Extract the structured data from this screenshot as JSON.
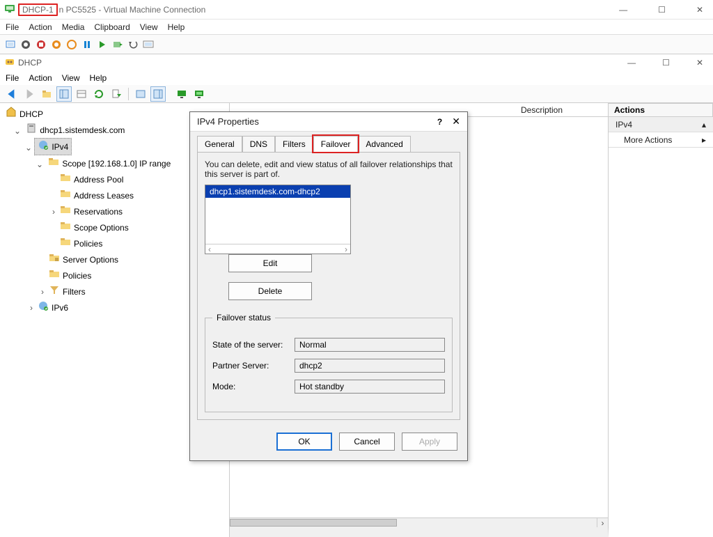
{
  "vm": {
    "title_highlighted": "DHCP-1",
    "title_rest": "n PC5525 - Virtual Machine Connection",
    "menu": [
      "File",
      "Action",
      "Media",
      "Clipboard",
      "View",
      "Help"
    ]
  },
  "inner": {
    "title": "DHCP",
    "menu": [
      "File",
      "Action",
      "View",
      "Help"
    ]
  },
  "tree": {
    "root": "DHCP",
    "server": "dhcp1.sistemdesk.com",
    "ipv4": "IPv4",
    "scope": "Scope [192.168.1.0] IP range",
    "scope_children": [
      "Address Pool",
      "Address Leases",
      "Reservations",
      "Scope Options",
      "Policies"
    ],
    "ipv4_children": [
      "Server Options",
      "Policies",
      "Filters"
    ],
    "ipv6": "IPv6"
  },
  "middle_headers": {
    "c3": "Description"
  },
  "dialog": {
    "title": "IPv4 Properties",
    "tabs": [
      "General",
      "DNS",
      "Filters",
      "Failover",
      "Advanced"
    ],
    "active_tab": "Failover",
    "desc": "You can delete, edit and view status of all failover relationships that this server is part of.",
    "item": "dhcp1.sistemdesk.com-dhcp2",
    "btn_edit": "Edit",
    "btn_delete": "Delete",
    "group": "Failover status",
    "state_label": "State of the server:",
    "state_value": "Normal",
    "partner_label": "Partner Server:",
    "partner_value": "dhcp2",
    "mode_label": "Mode:",
    "mode_value": "Hot standby",
    "ok": "OK",
    "cancel": "Cancel",
    "apply": "Apply"
  },
  "actions": {
    "header": "Actions",
    "group": "IPv4",
    "more": "More Actions"
  }
}
